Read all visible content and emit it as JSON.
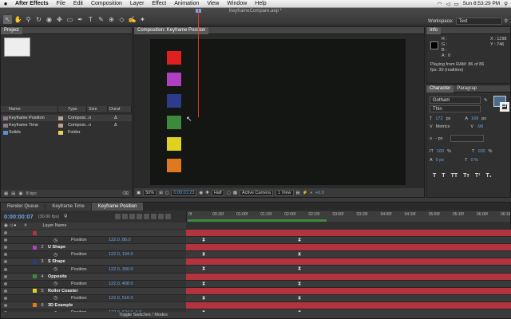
{
  "menubar": {
    "apple": "",
    "app": "After Effects",
    "items": [
      "File",
      "Edit",
      "Composition",
      "Layer",
      "Effect",
      "Animation",
      "View",
      "Window",
      "Help"
    ],
    "clock": "Sun 8:53:29 PM"
  },
  "toolbar": {
    "doc_title": "KeyframeCompare.aep *",
    "workspace_label": "Workspace:",
    "workspace_value": "Text",
    "tools": [
      "selection-tool",
      "hand-tool",
      "zoom-tool",
      "rotate-tool",
      "camera-tool",
      "pan-behind-tool",
      "rectangle-mask-tool",
      "pen-tool",
      "type-tool",
      "brush-tool",
      "clone-tool",
      "eraser-tool",
      "roto-brush-tool",
      "puppet-tool"
    ]
  },
  "project": {
    "tab": "Project",
    "columns": [
      "Name",
      "Type",
      "Size",
      "Durat"
    ],
    "items": [
      {
        "name": "Keyframe Position",
        "type": "Composi...n",
        "dur": "Δ",
        "color": "#b8a58f"
      },
      {
        "name": "Keyframe Time",
        "type": "Composi...n",
        "dur": "Δ",
        "color": "#b8a58f"
      },
      {
        "name": "Solids",
        "type": "Folder",
        "dur": "",
        "color": "#e6d35a"
      }
    ],
    "bottom_label": "8 bpc"
  },
  "comp": {
    "tab": "Composition: Keyframe Position",
    "squares": [
      "#e02020",
      "#b040c0",
      "#2d3c8a",
      "#3c8a3c",
      "#e0d020",
      "#e07820"
    ],
    "zoom": "50%",
    "timecode": "0:00:01:23",
    "resolution": "Half",
    "camera": "Active Camera",
    "view": "1 View",
    "exposure": "+0.0"
  },
  "info": {
    "tab": "Info",
    "r": "R :",
    "g": "G :",
    "b": "B :",
    "a": "A : 0",
    "x": "X : 1298",
    "y": "Y : 746",
    "msg1": "Playing from RAM: 86 of 86",
    "msg2": "fps: 30 (realtime)"
  },
  "character": {
    "tab1": "Character",
    "tab2": "Paragrap",
    "font": "Gotham",
    "style": "Thin",
    "size": "172",
    "size_unit": "px",
    "leading": "169",
    "leading_unit": "px",
    "kerning": "Metrics",
    "tracking": "-98",
    "stroke": "- px",
    "vscale": "100",
    "hscale": "100",
    "baseline": "0 px",
    "tsume": "0 %",
    "styles": [
      "T",
      "T",
      "TT",
      "Tт",
      "T¹",
      "T₁"
    ]
  },
  "timeline": {
    "tabs": [
      "Render Queue",
      "Keyframe Time",
      "Keyframe Position"
    ],
    "active_tab": 2,
    "timecode": "0:00:00:07",
    "fps": "(30.00 fps)",
    "layer_name_header": "Layer Name",
    "ticks": [
      "0f",
      "00:15f",
      "01:00f",
      "01:15f",
      "02:00f",
      "02:15f",
      "03:00f",
      "03:15f",
      "04:00f",
      "04:15f",
      "05:00f",
      "05:15f",
      "06:00f",
      "06:15"
    ],
    "rows": [
      {
        "kind": "layer",
        "num": "",
        "name": "",
        "color": "#b3343f",
        "value": ""
      },
      {
        "kind": "prop",
        "name": "Position",
        "value": "122.0, 86.0"
      },
      {
        "kind": "layer",
        "num": "2",
        "name": "U Shape",
        "color": "#b040c0",
        "value": ""
      },
      {
        "kind": "prop",
        "name": "Position",
        "value": "122.0, 194.0"
      },
      {
        "kind": "layer",
        "num": "3",
        "name": "S Shape",
        "color": "#2d3c8a",
        "value": ""
      },
      {
        "kind": "prop",
        "name": "Position",
        "value": "122.0, 300.0"
      },
      {
        "kind": "layer",
        "num": "4",
        "name": "Opposite",
        "color": "#3c8a3c",
        "value": ""
      },
      {
        "kind": "prop",
        "name": "Position",
        "value": "122.0, 408.0"
      },
      {
        "kind": "layer",
        "num": "5",
        "name": "Roller Coaster",
        "color": "#e0d020",
        "value": ""
      },
      {
        "kind": "prop",
        "name": "Position",
        "value": "122.0, 516.0"
      },
      {
        "kind": "layer",
        "num": "6",
        "name": "3D Example",
        "color": "#e07820",
        "value": ""
      },
      {
        "kind": "prop",
        "name": "Position",
        "value": "122.0, 624.0, 0.0"
      }
    ],
    "toggle_label": "Toggle Switches / Modes"
  }
}
